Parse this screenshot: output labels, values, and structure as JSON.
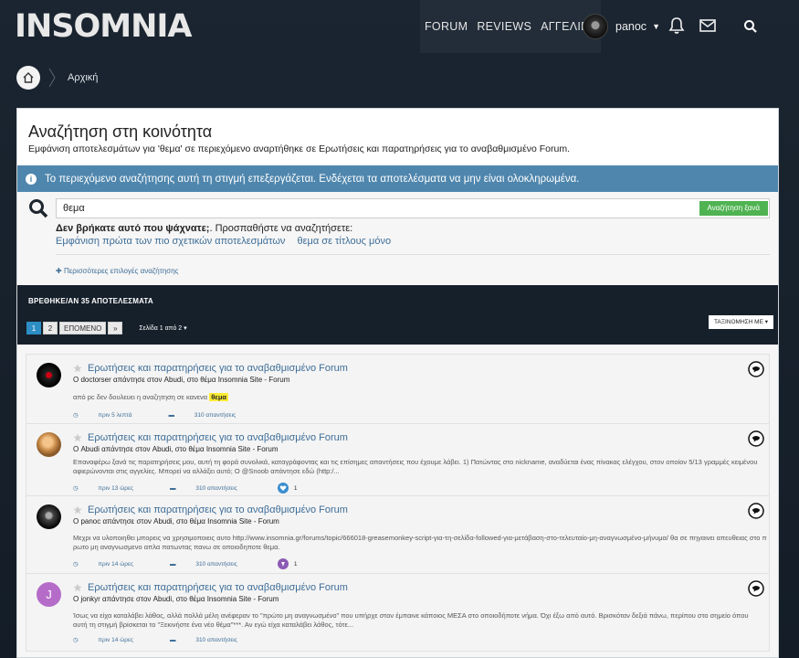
{
  "header": {
    "logo_text": "INSOMNIA",
    "nav": [
      "FORUM",
      "REVIEWS",
      "ΑΓΓΕΛΙΕΣ"
    ],
    "user_name": "panoc"
  },
  "breadcrumb": {
    "items": [
      "Αρχική"
    ]
  },
  "page": {
    "title": "Αναζήτηση στη κοινότητα",
    "subtitle": "Εμφάνιση αποτελεσμάτων για 'θεμα' σε περιεχόμενο αναρτήθηκε σε Ερωτήσεις και παρατηρήσεις για το αναβαθμισμένο Forum.",
    "info": "Το περιεχόμενο αναζήτησης αυτή τη στιγμή επεξεργάζεται. Ενδέχεται τα αποτελέσματα να μην είναι ολοκληρωμένα."
  },
  "search": {
    "value": "θεμα",
    "button": "Αναζήτηση ξανά",
    "not_found_bold": "Δεν βρήκατε αυτό που ψάχνατε;",
    "not_found_rest": ". Προσπαθήστε να αναζητήσετε:",
    "suggestion_1": "Εμφάνιση πρώτα των πιο σχετικών αποτελεσμάτων",
    "suggestion_2": "θεμα σε τίτλους μόνο",
    "more_options": "Περισσότερες επιλογές αναζήτησης"
  },
  "results_bar": {
    "found": "ΒΡΕΘΗΚΕ/ΑΝ 35 ΑΠΟΤΕΛΕΣΜΑΤΑ",
    "pages": [
      "1",
      "2"
    ],
    "next": "ΕΠΟΜΕΝΟ",
    "last": "»",
    "page_of": "Σελίδα 1 από 2",
    "sort": "ΤΑΞΙΝΟΜΗΣΗ ΜΕ"
  },
  "results": [
    {
      "title": "Ερωτήσεις και παρατηρήσεις για το αναβαθμισμένο Forum",
      "sub": "Ο doctorser απάντησε στον Abudi, στο θέμα Insomnia Site - Forum",
      "snippet_pre": "από pc δεν δουλευει η αναζητηση σε κανενα ",
      "snippet_hl": "θεμα",
      "time": "πριν 5 λεπτά",
      "replies": "310 απαντήσεις",
      "reactions": ""
    },
    {
      "title": "Ερωτήσεις και παρατηρήσεις για το αναβαθμισμένο Forum",
      "sub": "Ο Abudi απάντησε στον Abudi, στο θέμα Insomnia Site - Forum",
      "snippet_pre": "Επαναφέρω ξανά τις παρατηρήσεις μου, αυτή τη φορά συνολικά, καταγράφοντας και τις επίσημες απαντήσεις που έχουμε λάβει. 1) Πατώντας στο nickname, αναδύεται ένας πίνακας ελέγχου, στον οποίον 5/13 γραμμές κειμένου αφιερώνονται στις αγγελίες. Μπορεί να αλλάξει αυτό; Ο @Snoob απάντησε εδώ (http:/...",
      "snippet_hl": "",
      "time": "πριν 13 ώρες",
      "replies": "310 απαντήσεις",
      "reactions": "1"
    },
    {
      "title": "Ερωτήσεις και παρατηρήσεις για το αναβαθμισμένο Forum",
      "sub": "Ο panoc απάντησε στον Abudi, στο θέμα Insomnia Site - Forum",
      "snippet_pre": "Μεχρι να υλοποιηθει μπορεις να χρησιμοποιεις αυτο http://www.insomnia.gr/forums/topic/666018-greasemonkey-script-για-τη-σελίδα-followed-για-μετάβαση-στο-τελευταίο-μη-αναγνωσμένο-μήνυμα/ θα σε πηγαινει απευθειας στο πρωτο μη αναγνωσμενο απλα πατωντας πανω σε οποιοδηποτε θεμα.",
      "snippet_hl": "",
      "time": "πριν 14 ώρες",
      "replies": "310 απαντήσεις",
      "reactions": "1"
    },
    {
      "title": "Ερωτήσεις και παρατηρήσεις για το αναβαθμισμένο Forum",
      "sub": "Ο jonkyr απάντησε στον Abudi, στο θέμα Insomnia Site - Forum",
      "snippet_pre": "Ίσως να είχα καταλάβει λάθος, αλλά πολλά μέλη ανέφεραν το \"πρώτο μη αναγνωσμένο\" που υπήρχε στον έμπαινε κάποιος ΜΕΣΑ στο οποιοδήποτε νήμα. Όχι έξω από αυτό. Βρισκόταν δεξιά πάνω, περίπου στο σημείο όπου αυτή τη στιγμή βρίσκεται το \"Ξεκινήστε ένα νέο θέμα\"***. Αν εγώ είχα καταλάβει λάθος, τότε...",
      "snippet_hl": "",
      "time": "πριν 14 ώρες",
      "replies": "310 απαντήσεις",
      "reactions": ""
    }
  ],
  "avatar_letter": "J",
  "colors": {
    "accent_blue": "#4f86ad",
    "link_blue": "#3d6d97",
    "green": "#4fb351",
    "dark_bg": "#16202b",
    "highlight": "#ffec32"
  }
}
